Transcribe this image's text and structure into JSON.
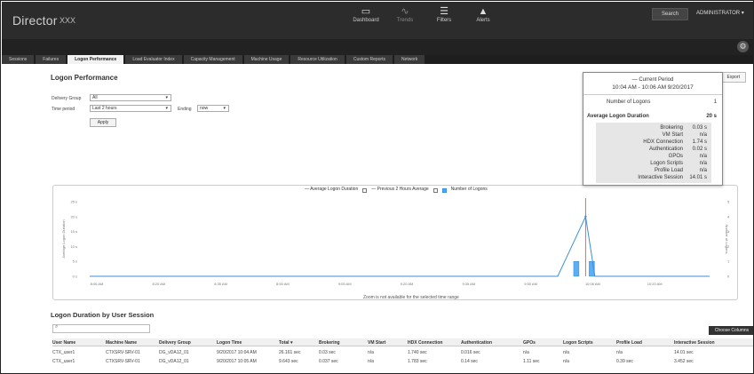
{
  "app": {
    "brand": "Director",
    "site": "XXX"
  },
  "topnav": [
    {
      "label": "Dashboard",
      "icon": "dashboard-icon"
    },
    {
      "label": "Trends",
      "icon": "trends-icon"
    },
    {
      "label": "Filters",
      "icon": "filters-icon"
    },
    {
      "label": "Alerts",
      "icon": "alerts-icon"
    }
  ],
  "header_right": {
    "search": "Search",
    "admin": "ADMINISTRATOR ▾"
  },
  "tabs": [
    "Sessions",
    "Failures",
    "Logon Performance",
    "Load Evaluator Index",
    "Capacity Management",
    "Machine Usage",
    "Resource Utilization",
    "Custom Reports",
    "Network"
  ],
  "active_tab": "Logon Performance",
  "page": {
    "title": "Logon Performance",
    "export": "Export"
  },
  "filters": {
    "delivery_group_label": "Delivery Group",
    "delivery_group_value": "All",
    "time_period_label": "Time period",
    "time_period_value": "Last 2 hours",
    "ending_label": "Ending",
    "ending_value": "now",
    "apply": "Apply"
  },
  "tooltip": {
    "heading": "— Current Period",
    "period": "10:04 AM - 10:06 AM 9/20/2017",
    "rows": [
      {
        "label": "Number of Logons",
        "value": "1"
      },
      {
        "label": "Average Logon Duration",
        "value": "20 s"
      }
    ],
    "details": [
      {
        "label": "Brokering",
        "value": "0.03 s"
      },
      {
        "label": "VM Start",
        "value": "n/a"
      },
      {
        "label": "HDX Connection",
        "value": "1.74 s"
      },
      {
        "label": "Authentication",
        "value": "0.02 s"
      },
      {
        "label": "GPOs",
        "value": "n/a"
      },
      {
        "label": "Logon Scripts",
        "value": "n/a"
      },
      {
        "label": "Profile Load",
        "value": "n/a"
      },
      {
        "label": "Interactive Session",
        "value": "14.01 s"
      }
    ]
  },
  "chart_data": {
    "type": "line",
    "legend": [
      "Average Logon Duration",
      "Previous 2 Hours Average",
      "Number of Logons"
    ],
    "x": [
      "8:06 AM",
      "8:20 AM",
      "8:35 AM",
      "8:50 AM",
      "9:05 AM",
      "9:20 AM",
      "9:35 AM",
      "9:50 AM",
      "10:06 AM",
      "10:20 AM"
    ],
    "ylabel_left": "Average Logon Duration",
    "ylabel_right": "Number of Logons",
    "y_left_ticks": [
      "0 s",
      "5 s",
      "10 s",
      "15 s",
      "20 s",
      "25 s"
    ],
    "y_right_ticks": [
      "0",
      "1",
      "2",
      "3",
      "4",
      "5"
    ],
    "ylim_left": [
      0,
      25
    ],
    "ylim_right": [
      0,
      5
    ],
    "series": [
      {
        "name": "Average Logon Duration",
        "axis": "left",
        "points": [
          [
            0,
            0
          ],
          [
            7.55,
            0
          ],
          [
            8.0,
            20
          ],
          [
            8.15,
            0
          ],
          [
            10,
            0
          ]
        ],
        "color": "#3b8fd9"
      },
      {
        "name": "Number of Logons",
        "axis": "right",
        "bars": [
          [
            7.85,
            1
          ],
          [
            8.1,
            1
          ]
        ],
        "color": "#5aaef5"
      }
    ],
    "marker_x": 8.0,
    "marker_color": "#e06666",
    "note": "Zoom is not available for the selected time range"
  },
  "table": {
    "title": "Logon Duration by User Session",
    "choose_columns": "Choose Columns",
    "columns": [
      "User Name",
      "Machine Name",
      "Delivery Group",
      "Logon Time",
      "Total ▾",
      "Brokering",
      "VM Start",
      "HDX Connection",
      "Authentication",
      "GPOs",
      "Logon Scripts",
      "Profile Load",
      "Interactive Session"
    ],
    "rows": [
      [
        "CTX_user1",
        "CTXSRV-SRV-01",
        "DG_vDA12_01",
        "9/20/2017 10:04 AM",
        "26.161 sec",
        "0.03 sec",
        "n/a",
        "1.740 sec",
        "0.016 sec",
        "n/a",
        "n/a",
        "n/a",
        "14.01 sec"
      ],
      [
        "CTX_user1",
        "CTXSRV-SRV-01",
        "DG_vDA12_01",
        "9/20/2017 10:05 AM",
        "9.643 sec",
        "0.037 sec",
        "n/a",
        "1.783 sec",
        "0.14 sec",
        "1.11 sec",
        "n/a",
        "0.39 sec",
        "3.452 sec"
      ]
    ]
  }
}
